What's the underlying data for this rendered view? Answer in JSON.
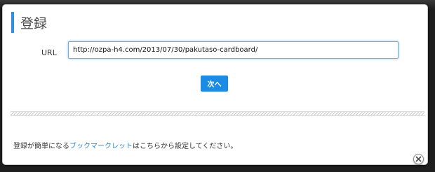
{
  "dialog": {
    "title": "登録",
    "url_label": "URL",
    "url_value": "http://ozpa-h4.com/2013/07/30/pakutaso-cardboard/",
    "next_button": "次へ",
    "footer": {
      "before_link": "登録が簡単になる",
      "link_text": "ブックマークレット",
      "after_link": "はこちらから設定してください。"
    }
  },
  "colors": {
    "accent": "#1a8ce6",
    "title_bar_accent": "#2f8fde",
    "link": "#2a8bd8"
  },
  "icons": {
    "close": "close-icon"
  }
}
